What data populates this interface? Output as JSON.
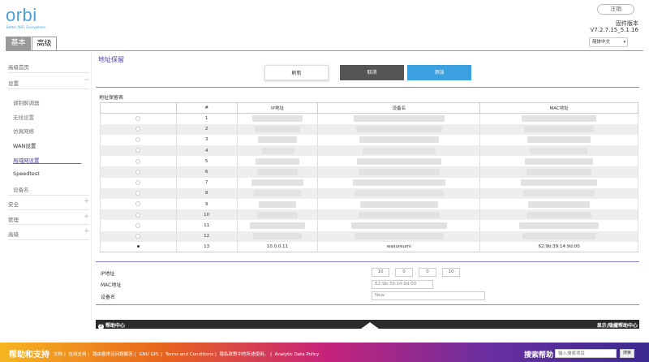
{
  "brand": {
    "logo": "orbi",
    "tagline": "Better WiFi. Everywhere."
  },
  "header": {
    "logout": "注销",
    "firmware_label": "固件版本",
    "firmware_version": "V7.2.7.15_5.1.16",
    "language": "简体中文"
  },
  "tabs": {
    "basic": "基本",
    "advanced": "高级"
  },
  "sidebar": {
    "home": "高级首页",
    "setup": "设置",
    "setup_sign": "−",
    "sub": [
      "调制解调器",
      "无线设置",
      "仿真网络",
      "WAN设置",
      "局域网设置",
      "Speedtest",
      "设备名"
    ],
    "security": "安全",
    "admin": "管理",
    "advanced": "高级",
    "plus": "+"
  },
  "main": {
    "title": "地址保留",
    "buttons": {
      "refresh": "刷新",
      "cancel": "取消",
      "add": "添加"
    },
    "table_title": "地址保留表",
    "columns": [
      "",
      "#",
      "IP地址",
      "设备名",
      "MAC地址"
    ],
    "rows": [
      {
        "num": "1",
        "ip": "",
        "name": "",
        "mac": "",
        "selected": false
      },
      {
        "num": "2",
        "ip": "",
        "name": "",
        "mac": "",
        "selected": false
      },
      {
        "num": "3",
        "ip": "",
        "name": "",
        "mac": "",
        "selected": false
      },
      {
        "num": "4",
        "ip": "",
        "name": "",
        "mac": "",
        "selected": false
      },
      {
        "num": "5",
        "ip": "",
        "name": "",
        "mac": "",
        "selected": false
      },
      {
        "num": "6",
        "ip": "",
        "name": "",
        "mac": "",
        "selected": false
      },
      {
        "num": "7",
        "ip": "",
        "name": "",
        "mac": "",
        "selected": false
      },
      {
        "num": "8",
        "ip": "",
        "name": "",
        "mac": "",
        "selected": false
      },
      {
        "num": "9",
        "ip": "",
        "name": "",
        "mac": "",
        "selected": false
      },
      {
        "num": "10",
        "ip": "",
        "name": "",
        "mac": "",
        "selected": false
      },
      {
        "num": "11",
        "ip": "",
        "name": "",
        "mac": "",
        "selected": false
      },
      {
        "num": "12",
        "ip": "",
        "name": "",
        "mac": "",
        "selected": false
      },
      {
        "num": "13",
        "ip": "10.0.0.11",
        "name": "wasureumi",
        "mac": "62:9b:39:14:9d:00",
        "selected": true
      }
    ],
    "form": {
      "ip_label": "IP地址",
      "ip_octets": [
        "10",
        "0",
        "0",
        "10"
      ],
      "mac_label": "MAC地址",
      "mac_value": "62:9b:39:14:9d:00",
      "name_label": "设备名",
      "name_value": "New"
    }
  },
  "help": {
    "center": "帮助中心",
    "toggle": "显示/隐藏帮助中心",
    "icon": "?"
  },
  "footer": {
    "title": "帮助和支持",
    "links": [
      "文档",
      "在线支持",
      "路由器常见问题解答",
      "GNU GPL",
      "Terms and Conditions",
      "隐私政策中的所述使用。",
      "Analytic Data Policy"
    ],
    "search_label": "搜索帮助",
    "search_placeholder": "输入搜索项目",
    "search_button": "搜索"
  },
  "colors": {
    "accent": "#4b3fa0",
    "add_button": "#3aa0e0",
    "logo": "#4a9fd8"
  }
}
